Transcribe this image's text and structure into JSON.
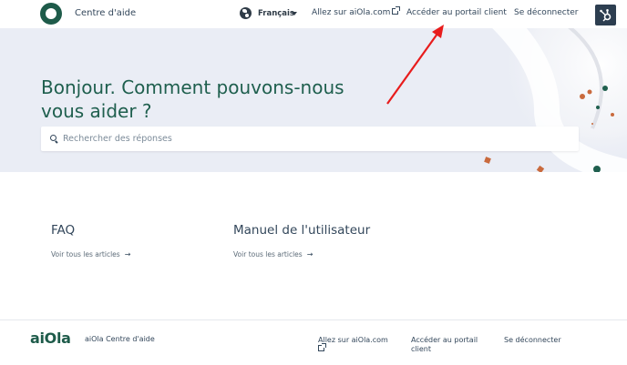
{
  "header": {
    "brand_title": "Centre d'aide",
    "language": "Français",
    "nav": {
      "site_link": "Allez sur aiOla.com",
      "portal_link": "Accéder au portail client",
      "logout_link": "Se déconnecter"
    },
    "hubspot_icon": "hubspot-sprocket-icon"
  },
  "hero": {
    "title": "Bonjour. Comment pouvons-nous vous aider ?",
    "search_placeholder": "Rechercher des réponses"
  },
  "categories": [
    {
      "title": "FAQ",
      "link": "Voir tous les articles"
    },
    {
      "title": "Manuel de l'utilisateur",
      "link": "Voir tous les articles"
    }
  ],
  "footer": {
    "logo": "aiOla",
    "brand_title": "aiOla Centre d'aide",
    "site_link": "Allez sur aiOla.com",
    "portal_link": "Accéder au portail client",
    "logout_link": "Se déconnecter"
  },
  "colors": {
    "brand_green": "#1f5f4e",
    "hero_bg": "#eaedf5",
    "annotation_red": "#e81c1c"
  }
}
